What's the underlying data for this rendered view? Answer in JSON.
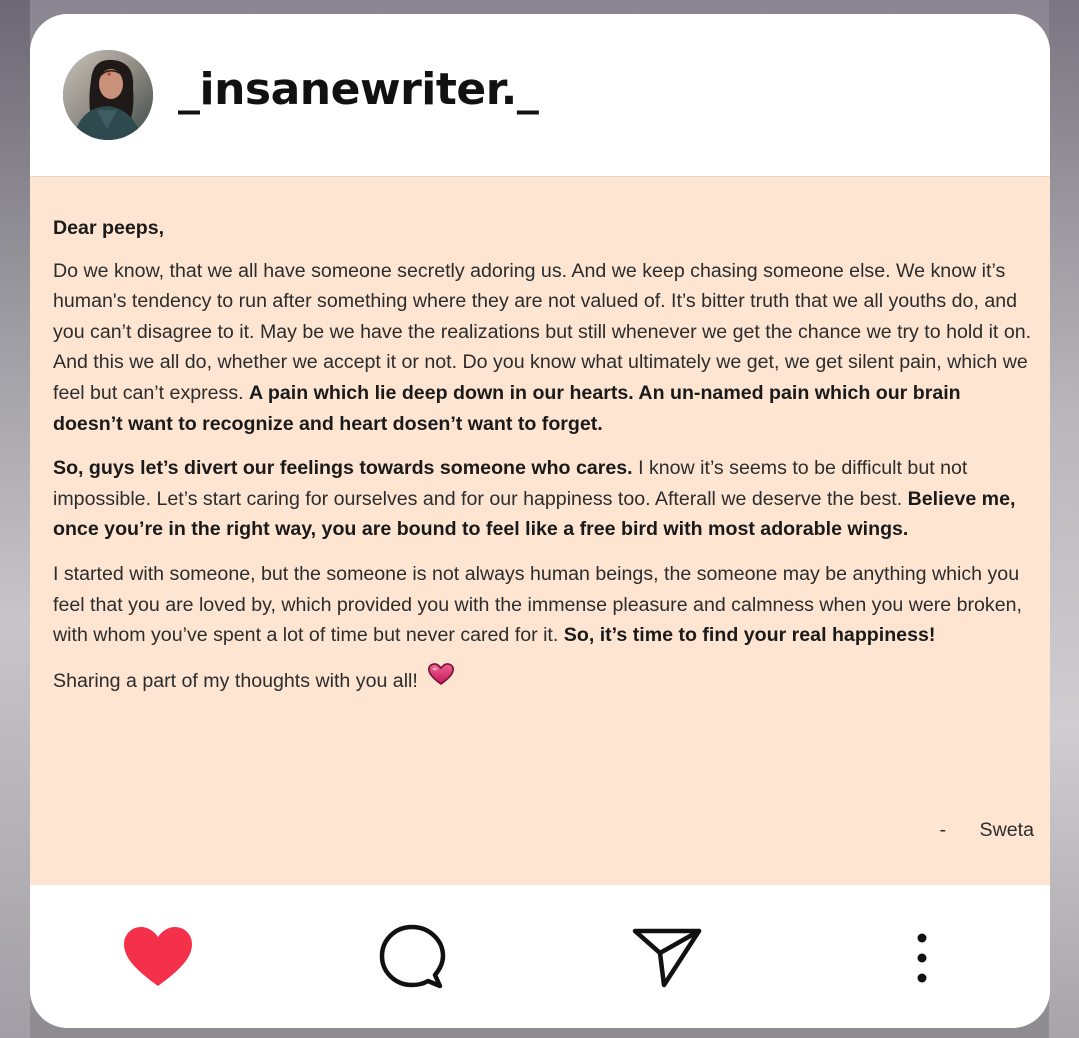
{
  "profile": {
    "username": "_insanewriter._",
    "avatar_icon": "avatar-photo"
  },
  "post": {
    "background": "#fde5d2",
    "greeting": "Dear peeps,",
    "paragraph1_normal": "Do we know, that we all have someone secretly adoring us. And we keep chasing someone else. We know it’s human's tendency to run after something where they are not valued of. It’s bitter truth that we all youths do, and you can’t disagree to it. May be we have the realizations but still whenever we get the chance we try to hold it on. And this we all do, whether we accept it or not. Do you know what ultimately we get, we get silent pain, which we feel but can’t express. ",
    "paragraph1_bold": "A pain which lie deep down in our hearts. An un-named pain which our brain doesn’t want to recognize and heart dosen’t want to forget.",
    "paragraph2_bold_start": "So, guys let’s divert our feelings towards someone who cares.",
    "paragraph2_normal": " I know it’s seems to be difficult but not impossible. Let’s start caring for ourselves and for our happiness too. Afterall we deserve the best. ",
    "paragraph2_bold_end": "Believe me, once you’re in the right way, you are bound to feel like a free bird with most adorable wings.",
    "paragraph3_normal": "I started with someone, but the someone is not always human beings, the someone may be anything which you feel that you are loved by, which provided you with the immense pleasure and calmness when you were broken, with whom you’ve spent a lot of time but never cared for it. ",
    "paragraph3_bold": "So, it’s time to find your real happiness!",
    "closing": "Sharing a part of my thoughts with you all! ",
    "signature_dash": "-",
    "signature_name": "Sweta"
  },
  "actions": {
    "like_icon": "heart-icon",
    "like_color": "#f5304a",
    "comment_icon": "comment-icon",
    "share_icon": "send-icon",
    "more_icon": "more-vertical-icon"
  }
}
